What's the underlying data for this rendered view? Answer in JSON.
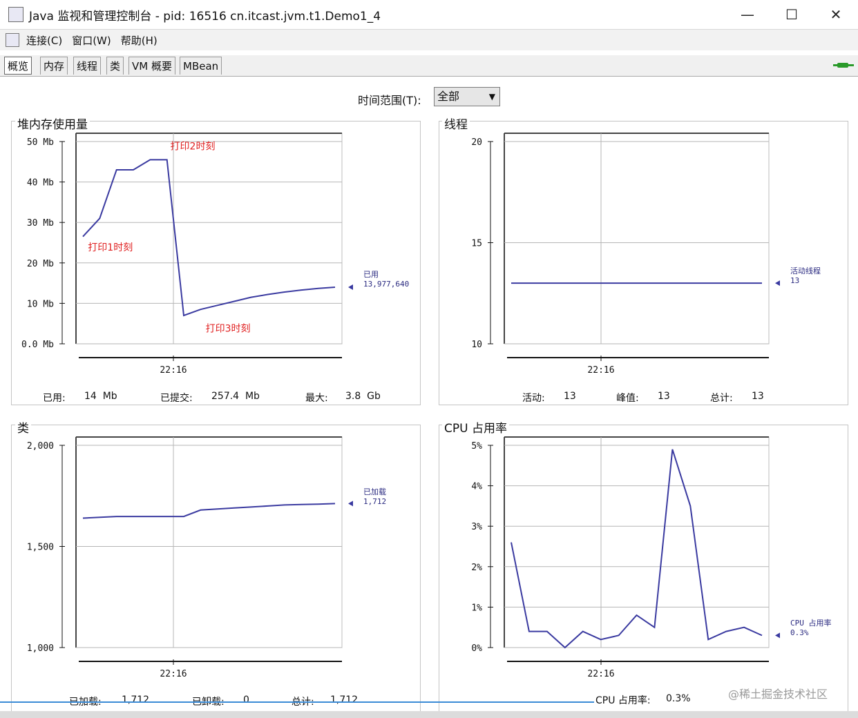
{
  "window": {
    "title": "Java 监视和管理控制台 - pid: 16516 cn.itcast.jvm.t1.Demo1_4",
    "minimize": "—",
    "maximize": "☐",
    "close": "✕"
  },
  "menu": {
    "items": [
      "连接(C)",
      "窗口(W)",
      "帮助(H)"
    ]
  },
  "tabs": [
    "概览",
    "内存",
    "线程",
    "类",
    "VM 概要",
    "MBean"
  ],
  "active_tab": "概览",
  "time_range": {
    "label": "时间范围(T):",
    "value": "全部"
  },
  "panels": {
    "heap": {
      "title": "堆内存使用量",
      "stats": {
        "used_label": "已用:",
        "used_value": "14  Mb",
        "committed_label": "已提交:",
        "committed_value": "257.4  Mb",
        "max_label": "最大:",
        "max_value": "3.8  Gb"
      }
    },
    "threads": {
      "title": "线程",
      "stats": {
        "live_label": "活动:",
        "live_value": "13",
        "peak_label": "峰值:",
        "peak_value": "13",
        "total_label": "总计:",
        "total_value": "13"
      }
    },
    "classes": {
      "title": "类",
      "stats": {
        "loaded_label": "已加载:",
        "loaded_value": "1,712",
        "unloaded_label": "已卸载:",
        "unloaded_value": "0",
        "total_label": "总计:",
        "total_value": "1,712"
      }
    },
    "cpu": {
      "title": "CPU 占用率",
      "stats": {
        "usage_label": "CPU 占用率:",
        "usage_value": "0.3%"
      }
    }
  },
  "watermark": "@稀土掘金技术社区",
  "chart_data": [
    {
      "type": "line",
      "name": "heap",
      "y_ticks": [
        "0.0 Mb",
        "10 Mb",
        "20 Mb",
        "30 Mb",
        "40 Mb",
        "50 Mb"
      ],
      "ylim": [
        0,
        50
      ],
      "x_tick": "22:16",
      "x": [
        0,
        1,
        2,
        3,
        4,
        5,
        6,
        7,
        8,
        9,
        10,
        11,
        12,
        13,
        14,
        15
      ],
      "values": [
        26.5,
        31,
        43,
        43,
        45.5,
        45.5,
        7,
        8.5,
        9.5,
        10.5,
        11.5,
        12.2,
        12.8,
        13.3,
        13.7,
        14
      ],
      "legend_name": "已用",
      "legend_value": "13,977,640",
      "color": "#3a3aa0",
      "annotations": [
        {
          "text": "打印1时刻",
          "x": 0.3,
          "y": 23
        },
        {
          "text": "打印2时刻",
          "x": 5.2,
          "y": 48
        },
        {
          "text": "打印3时刻",
          "x": 7.3,
          "y": 3
        }
      ]
    },
    {
      "type": "line",
      "name": "threads",
      "y_ticks": [
        "10",
        "15",
        "20"
      ],
      "ylim": [
        10,
        20
      ],
      "x_tick": "22:16",
      "x": [
        0,
        15
      ],
      "values": [
        13,
        13
      ],
      "legend_name": "活动线程",
      "legend_value": "13",
      "color": "#3a3aa0"
    },
    {
      "type": "line",
      "name": "classes",
      "y_ticks": [
        "1,000",
        "1,500",
        "2,000"
      ],
      "ylim": [
        1000,
        2000
      ],
      "x_tick": "22:16",
      "x": [
        0,
        2,
        4,
        6,
        7,
        8,
        9,
        10,
        11,
        12,
        13,
        14,
        15
      ],
      "values": [
        1640,
        1648,
        1648,
        1648,
        1680,
        1685,
        1690,
        1695,
        1700,
        1705,
        1707,
        1709,
        1712
      ],
      "legend_name": "已加载",
      "legend_value": "1,712",
      "color": "#3a3aa0"
    },
    {
      "type": "line",
      "name": "cpu",
      "y_ticks": [
        "0%",
        "1%",
        "2%",
        "3%",
        "4%",
        "5%"
      ],
      "ylim": [
        0,
        5
      ],
      "x_tick": "22:16",
      "x": [
        0,
        1,
        2,
        3,
        4,
        5,
        6,
        7,
        8,
        9,
        10,
        11,
        12,
        13,
        14
      ],
      "values": [
        2.6,
        0.4,
        0.4,
        0.0,
        0.4,
        0.2,
        0.3,
        0.8,
        0.5,
        4.9,
        3.5,
        0.2,
        0.4,
        0.5,
        0.3
      ],
      "legend_name": "CPU 占用率",
      "legend_value": "0.3%",
      "color": "#3a3aa0"
    }
  ]
}
